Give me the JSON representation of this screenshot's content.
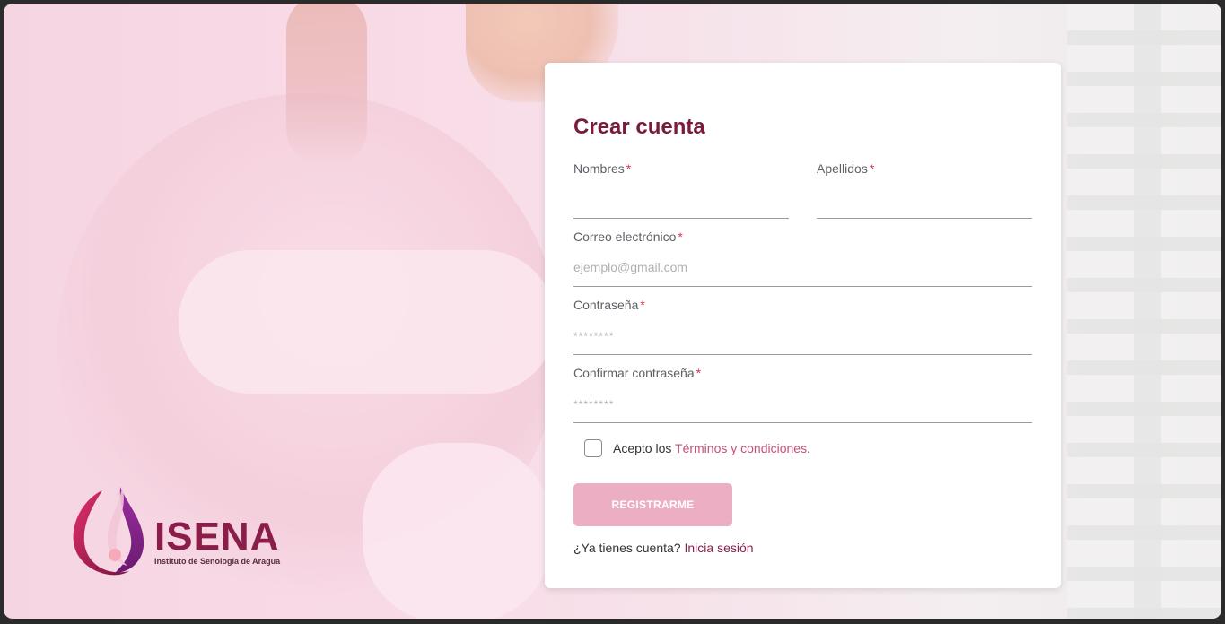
{
  "brand": {
    "name": "ISENA",
    "subtitle": "Instituto de Senología de Aragua",
    "primary_color": "#8a1d4a",
    "accent_color": "#c6507a"
  },
  "form": {
    "title": "Crear cuenta",
    "required_mark": "*",
    "fields": {
      "nombres": {
        "label": "Nombres",
        "value": "",
        "placeholder": ""
      },
      "apellidos": {
        "label": "Apellidos",
        "value": "",
        "placeholder": ""
      },
      "correo": {
        "label": "Correo electrónico",
        "value": "",
        "placeholder": "ejemplo@gmail.com"
      },
      "password": {
        "label": "Contraseña",
        "value": "",
        "placeholder": "********"
      },
      "confirm": {
        "label": "Confirmar contraseña",
        "value": "",
        "placeholder": "********"
      }
    },
    "terms": {
      "prefix": "Acepto los ",
      "link_text": "Términos y condiciones",
      "suffix": ".",
      "checked": false
    },
    "submit_label": "REGISTRARME",
    "login_prompt": "¿Ya tienes cuenta?",
    "login_link": "Inicia sesión"
  }
}
